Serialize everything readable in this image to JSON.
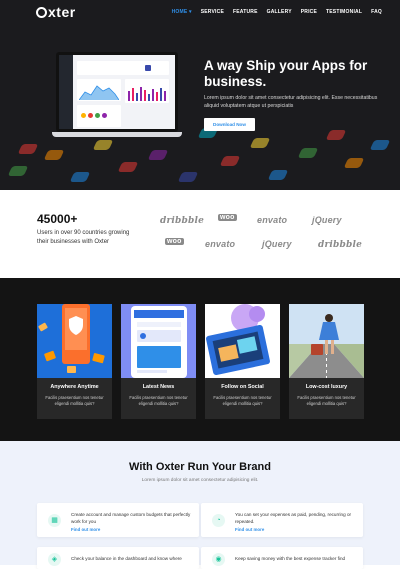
{
  "header": {
    "logo": "xter",
    "nav": [
      {
        "label": "HOME ▾",
        "active": true
      },
      {
        "label": "SERVICE",
        "active": false
      },
      {
        "label": "FEATURE",
        "active": false
      },
      {
        "label": "GALLERY",
        "active": false
      },
      {
        "label": "PRICE",
        "active": false
      },
      {
        "label": "TESTIMONIAL",
        "active": false
      },
      {
        "label": "FAQ",
        "active": false
      }
    ]
  },
  "hero": {
    "title": "A way Ship your Apps for business.",
    "subtitle": "Lorem ipsum dolor sit amet consectetur adipisicing elit. Esse necessitatibus aliquid voluptatem atque ut perspiciatis",
    "button": "Download Now"
  },
  "stats": {
    "number": "45000+",
    "description": "Users in over 90 countries growing their businesses with Oxter",
    "brands": [
      "dribbble",
      "woo",
      "envato",
      "jQuery",
      "woo",
      "envato",
      "jQuery",
      "dribbble"
    ]
  },
  "features": [
    {
      "title": "Anywhere Anytime",
      "desc": "Facilis praesentium nos tenetur eligendi mollitia quis?"
    },
    {
      "title": "Latest News",
      "desc": "Facilis praesentium nos tenetur eligendi mollitia quis?"
    },
    {
      "title": "Follow on Social",
      "desc": "Facilis praesentium nos tenetur eligendi mollitia quis?"
    },
    {
      "title": "Low-cost luxury",
      "desc": "Facilis praesentium nos tenetur eligendi mollitia quis?"
    }
  ],
  "run_brand": {
    "title": "With Oxter Run Your Brand",
    "subtitle": "Lorem ipsum dolor sit amet consectetur adipisicing elit.",
    "items": [
      {
        "text": "Create account and manage custom budgets that perfectly work for you",
        "link": "Find out more"
      },
      {
        "text": "You can set your expenses as paid, pending, recurring or repeated.",
        "link": "Find out more"
      },
      {
        "text": "Check your balance in the dashboard and know where",
        "link": ""
      },
      {
        "text": "Keep saving money with the best expense tracker find",
        "link": ""
      }
    ]
  },
  "colors": {
    "accent": "#2f8fe8",
    "dark": "#141414",
    "hero": "#1b1b1e",
    "green": "#19c49a"
  }
}
